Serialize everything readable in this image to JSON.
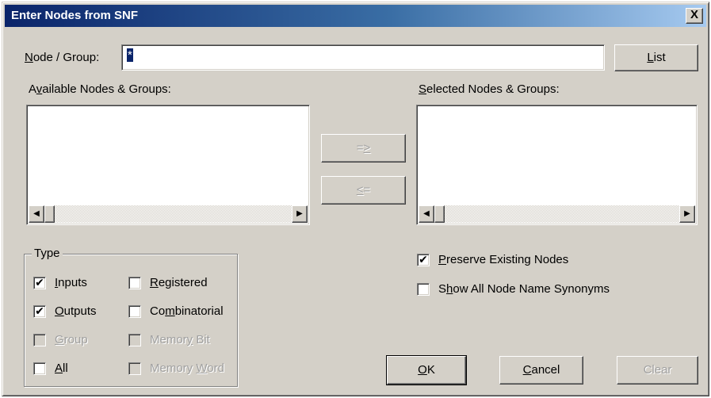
{
  "window": {
    "title": "Enter Nodes from SNF",
    "close_glyph": "X"
  },
  "node_group": {
    "label_prefix": "N",
    "label_rest": "ode / Group:",
    "value": "*"
  },
  "buttons": {
    "list": {
      "u": "L",
      "rest": "ist"
    },
    "add": {
      "pre": "=",
      "u": ">",
      "rest": ""
    },
    "remove": {
      "pre": "",
      "u": "<",
      "rest": "="
    },
    "ok": {
      "u": "O",
      "rest": "K"
    },
    "cancel": {
      "u": "C",
      "rest": "ancel"
    },
    "clear": "Clear"
  },
  "available": {
    "pre": "A",
    "u": "v",
    "rest": "ailable Nodes & Groups:"
  },
  "selected": {
    "u": "S",
    "rest": "elected Nodes & Groups:"
  },
  "type_group": {
    "label": "Type",
    "items": [
      {
        "pre": "",
        "u": "I",
        "rest": "nputs",
        "checked": "✔",
        "enabled": true
      },
      {
        "pre": "",
        "u": "O",
        "rest": "utputs",
        "checked": "✔",
        "enabled": true
      },
      {
        "pre": "",
        "u": "G",
        "rest": "roup",
        "checked": "",
        "enabled": false
      },
      {
        "pre": "",
        "u": "A",
        "rest": "ll",
        "checked": "",
        "enabled": true
      },
      {
        "pre": "",
        "u": "R",
        "rest": "egistered",
        "checked": "",
        "enabled": true
      },
      {
        "pre": "Co",
        "u": "m",
        "rest": "binatorial",
        "checked": "",
        "enabled": true
      },
      {
        "pre": "Memor",
        "u": "y",
        "rest": " Bit",
        "checked": "",
        "enabled": false
      },
      {
        "pre": "Memory ",
        "u": "W",
        "rest": "ord",
        "checked": "",
        "enabled": false
      }
    ]
  },
  "options": {
    "preserve": {
      "u": "P",
      "rest": "reserve Existing Nodes",
      "checked": "✔"
    },
    "synonyms": {
      "pre": "S",
      "u": "h",
      "rest": "ow All Node Name Synonyms",
      "checked": ""
    }
  },
  "scroll": {
    "left": "◀",
    "right": "▶"
  }
}
